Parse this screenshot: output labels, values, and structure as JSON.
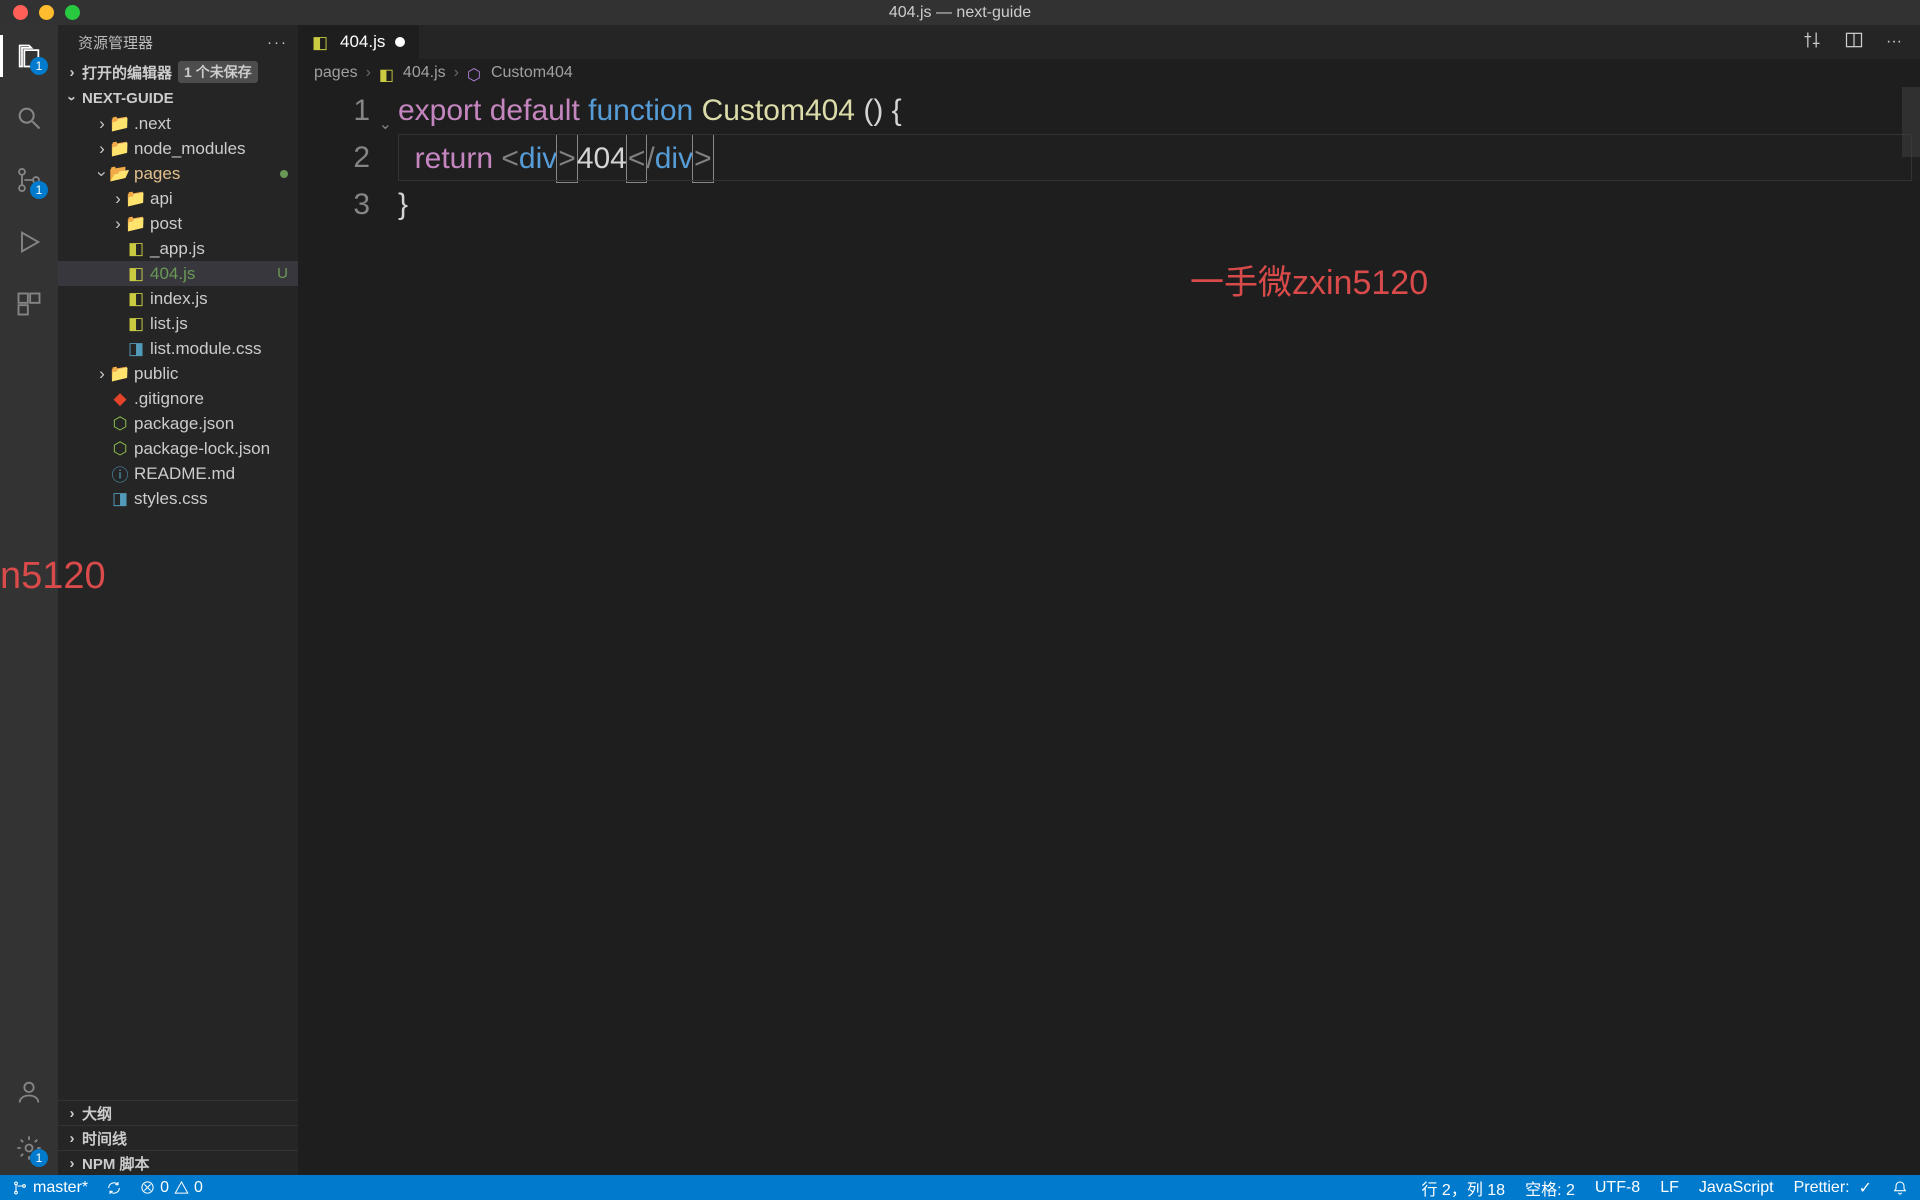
{
  "title": "404.js — next-guide",
  "activity": {
    "explorer_badge": "1",
    "scm_badge": "1",
    "settings_badge": "1"
  },
  "sidebar": {
    "header": "资源管理器",
    "open_editors": "打开的编辑器",
    "unsaved_badge": "1 个未保存",
    "project": "NEXT-GUIDE",
    "tree": [
      {
        "label": ".next",
        "type": "folder",
        "depth": 2
      },
      {
        "label": "node_modules",
        "type": "folder",
        "depth": 2
      },
      {
        "label": "pages",
        "type": "folder-open-green",
        "depth": 2,
        "open": true,
        "modified": true
      },
      {
        "label": "api",
        "type": "folder-yellow",
        "depth": 3
      },
      {
        "label": "post",
        "type": "folder-yellow",
        "depth": 3
      },
      {
        "label": "_app.js",
        "type": "js",
        "depth": 3
      },
      {
        "label": "404.js",
        "type": "js",
        "depth": 3,
        "selected": true,
        "status": "U"
      },
      {
        "label": "index.js",
        "type": "js",
        "depth": 3
      },
      {
        "label": "list.js",
        "type": "js",
        "depth": 3
      },
      {
        "label": "list.module.css",
        "type": "css",
        "depth": 3
      },
      {
        "label": "public",
        "type": "folder",
        "depth": 2
      },
      {
        "label": ".gitignore",
        "type": "git",
        "depth": 2
      },
      {
        "label": "package.json",
        "type": "npm",
        "depth": 2
      },
      {
        "label": "package-lock.json",
        "type": "npm",
        "depth": 2
      },
      {
        "label": "README.md",
        "type": "info",
        "depth": 2
      },
      {
        "label": "styles.css",
        "type": "css",
        "depth": 2
      }
    ],
    "footer": [
      "大纲",
      "时间线",
      "NPM 脚本"
    ]
  },
  "tab": {
    "label": "404.js"
  },
  "breadcrumbs": [
    "pages",
    "404.js",
    "Custom404"
  ],
  "code": {
    "line1": {
      "export": "export",
      "default": "default",
      "function": "function",
      "name": "Custom404",
      "paren": " () ",
      "brace": "{"
    },
    "line2": {
      "return": "return",
      "lt": "<",
      "div": "div",
      "gt1": ">",
      "text": "404",
      "lt2": "<",
      "slash": "/",
      "div2": "div",
      "gt2": ">"
    },
    "line3": {
      "brace": "}"
    }
  },
  "watermark1": "n5120",
  "watermark2": "一手微zxin5120",
  "status": {
    "branch": "master*",
    "sync": "",
    "errors": "0",
    "warnings": "0",
    "line_col": "行 2，列 18",
    "spaces": "空格: 2",
    "encoding": "UTF-8",
    "eol": "LF",
    "lang": "JavaScript",
    "prettier": "Prettier: "
  }
}
